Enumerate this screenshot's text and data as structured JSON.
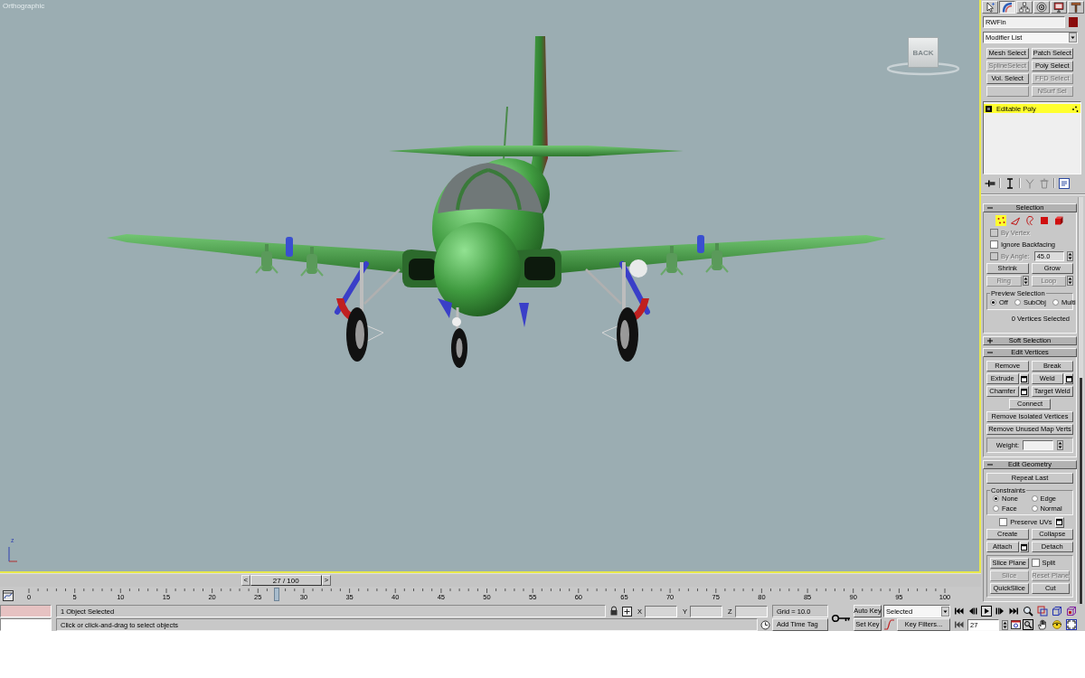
{
  "viewport": {
    "label": "Orthographic",
    "active": true,
    "view_cube": "BACK",
    "axis_label": "z"
  },
  "command_panel": {
    "tabs": [
      {
        "kind": "create",
        "selected": false
      },
      {
        "kind": "modify",
        "selected": true
      },
      {
        "kind": "hierarchy",
        "selected": false
      },
      {
        "kind": "motion",
        "selected": false
      },
      {
        "kind": "display",
        "selected": false
      },
      {
        "kind": "utilities",
        "selected": false
      }
    ],
    "object_name": "RWFin",
    "modifier_list": "Modifier List",
    "modifier_buttons": [
      {
        "label": "Mesh Select",
        "disabled": false
      },
      {
        "label": "Patch Select",
        "disabled": false
      },
      {
        "label": "SplineSelect",
        "disabled": true
      },
      {
        "label": "Poly Select",
        "disabled": false
      },
      {
        "label": "Vol. Select",
        "disabled": false
      },
      {
        "label": "FFD Select",
        "disabled": true
      },
      {
        "disabled": true
      },
      {
        "label": "NSurf Sel",
        "disabled": true
      }
    ],
    "modifier_stack": [
      {
        "label": "Editable Poly",
        "selected": true
      }
    ],
    "stack_tools": [
      {
        "kind": "pin",
        "disabled": false
      },
      {
        "kind": "show_end_result",
        "disabled": false
      },
      {
        "kind": "make_unique",
        "disabled": true
      },
      {
        "kind": "remove_modifier",
        "disabled": true
      },
      {
        "kind": "configure_sets",
        "disabled": false
      }
    ]
  },
  "selection_rollout": {
    "title": "Selection",
    "expanded": true,
    "levels": [
      {
        "kind": "vertex",
        "selected": true
      },
      {
        "kind": "edge",
        "selected": false
      },
      {
        "kind": "border",
        "selected": false
      },
      {
        "kind": "polygon",
        "selected": false
      },
      {
        "kind": "element",
        "selected": false
      }
    ],
    "options": [
      {
        "label": "By Vertex",
        "checked": false,
        "disabled": true
      },
      {
        "label": "Ignore Backfacing",
        "checked": false,
        "disabled": false
      },
      {
        "label": "By Angle:",
        "checked": false,
        "disabled": true,
        "value": "45.0"
      }
    ],
    "shrink_grow": [
      {
        "label": "Shrink",
        "disabled": false
      },
      {
        "label": "Grow",
        "disabled": false
      }
    ],
    "ring_loop": [
      {
        "label": "Ring",
        "disabled": true
      },
      {
        "label": "Loop",
        "disabled": true
      }
    ],
    "preview": {
      "title": "Preview Selection",
      "options": [
        {
          "label": "Off",
          "selected": true
        },
        {
          "label": "SubObj",
          "selected": false
        },
        {
          "label": "Multi",
          "selected": false
        }
      ]
    },
    "status": "0 Vertices Selected"
  },
  "soft_selection_rollout": {
    "title": "Soft Selection",
    "expanded": false
  },
  "edit_vertices_rollout": {
    "title": "Edit Vertices",
    "expanded": true,
    "button_rows": [
      [
        {
          "label": "Remove",
          "settings": false
        },
        {
          "label": "Break",
          "settings": false
        }
      ],
      [
        {
          "label": "Extrude",
          "settings": true
        },
        {
          "label": "Weld",
          "settings": true
        }
      ],
      [
        {
          "label": "Chamfer",
          "settings": true
        },
        {
          "label": "Target Weld",
          "settings": false
        }
      ],
      [
        {
          "label": "Connect",
          "settings": false
        }
      ],
      [
        {
          "label": "Remove Isolated Vertices",
          "settings": false
        }
      ],
      [
        {
          "label": "Remove Unused Map Verts",
          "settings": false
        }
      ]
    ],
    "weight_label": "Weight:"
  },
  "edit_geometry_rollout": {
    "title": "Edit Geometry",
    "expanded": true,
    "repeat_last": "Repeat Last",
    "constraints": {
      "title": "Constraints",
      "options": [
        {
          "label": "None",
          "selected": true
        },
        {
          "label": "Edge",
          "selected": false
        },
        {
          "label": "Face",
          "selected": false
        },
        {
          "label": "Normal",
          "selected": false
        }
      ]
    },
    "preserve_uvs": {
      "label": "Preserve UVs",
      "checked": false
    },
    "button_rows": [
      [
        {
          "label": "Create",
          "settings": false
        },
        {
          "label": "Collapse",
          "settings": false
        }
      ],
      [
        {
          "label": "Attach",
          "settings": true
        },
        {
          "label": "Detach",
          "settings": false
        }
      ]
    ],
    "slice_plane": "Slice Plane",
    "split": {
      "label": "Split",
      "checked": false
    },
    "slice_rows": [
      [
        {
          "label": "Slice",
          "disabled": true
        },
        {
          "label": "Reset Plane",
          "disabled": true
        }
      ],
      [
        {
          "label": "QuickSlice",
          "disabled": false
        },
        {
          "label": "Cut",
          "disabled": false
        }
      ]
    ]
  },
  "time_slider": {
    "previous": "<",
    "label": "27 / 100",
    "next": ">",
    "level": 0.27
  },
  "track_bar": {
    "labels": [
      "0",
      "5",
      "10",
      "15",
      "20",
      "25",
      "30",
      "35",
      "40",
      "45",
      "50",
      "55",
      "60",
      "65",
      "70",
      "75",
      "80",
      "85",
      "90",
      "95",
      "100"
    ],
    "level": 0.27
  },
  "status_bar": {
    "selection_info": "1 Object Selected",
    "prompt": "Click or click-and-drag to select objects",
    "coordinates": [
      {
        "label": "X"
      },
      {
        "label": "Y"
      },
      {
        "label": "Z"
      }
    ],
    "grid": "Grid = 10.0",
    "time_tag": "Add Time Tag"
  },
  "animation": {
    "auto_key": {
      "label": "Auto Key",
      "on": false
    },
    "set_key": "Set Key",
    "key_set": "Selected",
    "key_filters": "Key Filters...",
    "frame": "27"
  }
}
